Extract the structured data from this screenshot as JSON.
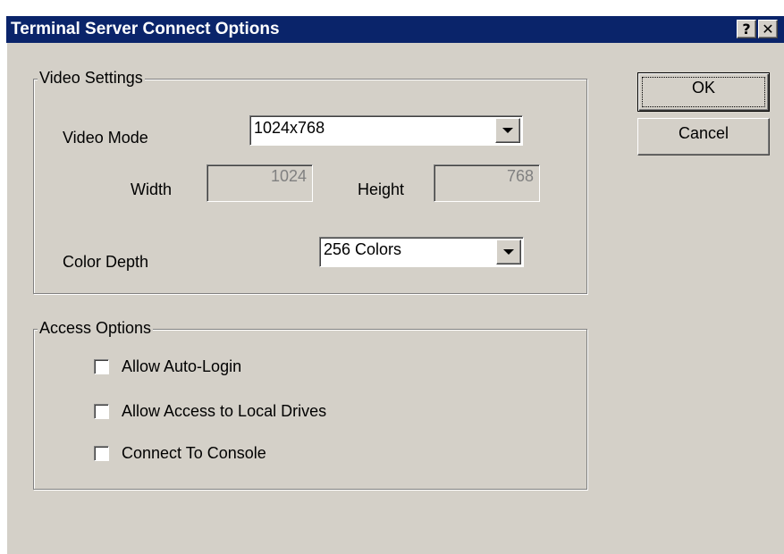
{
  "window": {
    "title": "Terminal Server Connect Options",
    "help_button": "?",
    "close_button": "✕"
  },
  "video_settings": {
    "group_label": "Video Settings",
    "video_mode_label": "Video Mode",
    "video_mode_value": "1024x768",
    "width_label": "Width",
    "width_value": "1024",
    "height_label": "Height",
    "height_value": "768",
    "color_depth_label": "Color Depth",
    "color_depth_value": "256 Colors"
  },
  "access_options": {
    "group_label": "Access Options",
    "items": [
      {
        "label": "Allow Auto-Login",
        "checked": false
      },
      {
        "label": "Allow Access to Local Drives",
        "checked": false
      },
      {
        "label": "Connect To Console",
        "checked": false
      }
    ]
  },
  "buttons": {
    "ok": "OK",
    "cancel": "Cancel"
  },
  "colors": {
    "title_bar": "#0a246a",
    "face": "#d4d0c8"
  }
}
